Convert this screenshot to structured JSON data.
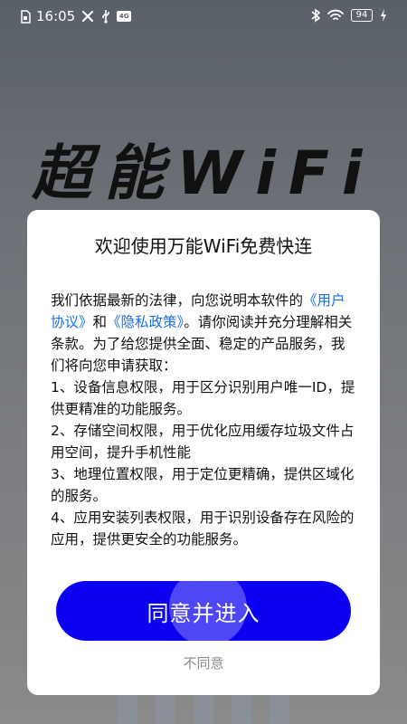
{
  "status_bar": {
    "time": "16:05",
    "battery": "94",
    "sim_badge": "4G"
  },
  "background": {
    "logo_text": "超能WiFi"
  },
  "dialog": {
    "title": "欢迎使用万能WiFi免费快连",
    "intro_before": "我们依据最新的法律，向您说明本软件的",
    "link_user_agreement": "《用户协议》",
    "and_text": "和",
    "link_privacy_policy": "《隐私政策》",
    "intro_after": "。请你阅读并充分理解相关条款。为了给您提供全面、稳定的产品服务，我们将向您申请获取：",
    "items": [
      "1、设备信息权限，用于区分识别用户唯一ID，提供更精准的功能服务。",
      "2、存储空间权限，用于优化应用缓存垃圾文件占用空间，提升手机性能",
      "3、地理位置权限，用于定位更精确，提供区域化的服务。",
      "4、应用安装列表权限，用于识别设备存在风险的应用，提供更安全的功能服务。"
    ],
    "agree_button": "同意并进入",
    "disagree_button": "不同意"
  }
}
